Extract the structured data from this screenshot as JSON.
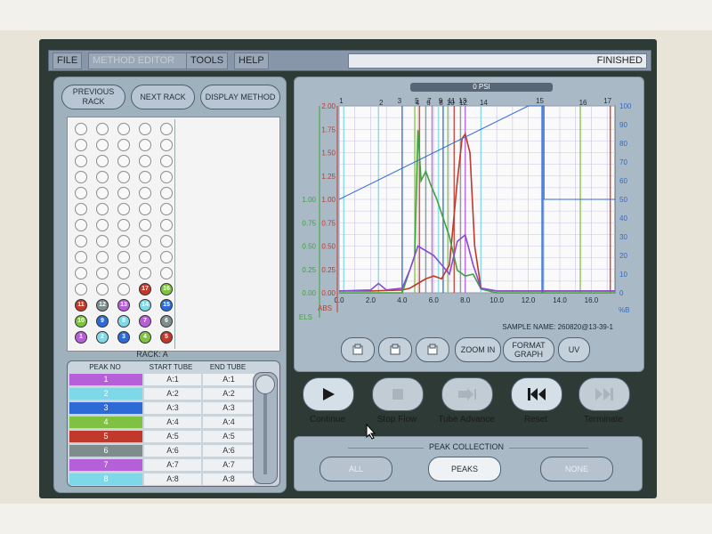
{
  "menu": {
    "items": [
      {
        "label": "FILE",
        "enabled": true
      },
      {
        "label": "METHOD EDITOR",
        "enabled": false
      },
      {
        "label": "TOOLS",
        "enabled": true
      },
      {
        "label": "HELP",
        "enabled": true
      }
    ],
    "status": "FINISHED"
  },
  "rack_nav": {
    "prev": "PREVIOUS RACK",
    "next": "NEXT RACK",
    "display": "DISPLAY METHOD"
  },
  "rack": {
    "label": "RACK: A",
    "filled_tubes": [
      {
        "col": 3,
        "row": 10,
        "num": "17",
        "color": "#c0392b"
      },
      {
        "col": 4,
        "row": 10,
        "num": "16",
        "color": "#7fc241"
      },
      {
        "col": 0,
        "row": 11,
        "num": "11",
        "color": "#c0392b"
      },
      {
        "col": 1,
        "row": 11,
        "num": "12",
        "color": "#7f8c8d"
      },
      {
        "col": 2,
        "row": 11,
        "num": "13",
        "color": "#b55fd8"
      },
      {
        "col": 3,
        "row": 11,
        "num": "14",
        "color": "#7fd8e8"
      },
      {
        "col": 4,
        "row": 11,
        "num": "15",
        "color": "#2e6ad6"
      },
      {
        "col": 0,
        "row": 12,
        "num": "10",
        "color": "#7fc241"
      },
      {
        "col": 1,
        "row": 12,
        "num": "9",
        "color": "#2e6ad6"
      },
      {
        "col": 2,
        "row": 12,
        "num": "8",
        "color": "#7fd8e8"
      },
      {
        "col": 3,
        "row": 12,
        "num": "7",
        "color": "#b55fd8"
      },
      {
        "col": 4,
        "row": 12,
        "num": "6",
        "color": "#7f8c8d"
      },
      {
        "col": 0,
        "row": 13,
        "num": "1",
        "color": "#b55fd8"
      },
      {
        "col": 1,
        "row": 13,
        "num": "2",
        "color": "#7fd8e8"
      },
      {
        "col": 2,
        "row": 13,
        "num": "3",
        "color": "#2e6ad6"
      },
      {
        "col": 3,
        "row": 13,
        "num": "4",
        "color": "#7fc241"
      },
      {
        "col": 4,
        "row": 13,
        "num": "5",
        "color": "#c0392b"
      }
    ]
  },
  "peak_table": {
    "headers": [
      "PEAK NO",
      "START TUBE",
      "END TUBE"
    ],
    "rows": [
      {
        "peak": "1",
        "start": "A:1",
        "end": "A:1",
        "color": "#b55fd8"
      },
      {
        "peak": "2",
        "start": "A:2",
        "end": "A:2",
        "color": "#7fd8e8"
      },
      {
        "peak": "3",
        "start": "A:3",
        "end": "A:3",
        "color": "#2e6ad6"
      },
      {
        "peak": "4",
        "start": "A:4",
        "end": "A:4",
        "color": "#7fc241"
      },
      {
        "peak": "5",
        "start": "A:5",
        "end": "A:5",
        "color": "#c0392b"
      },
      {
        "peak": "6",
        "start": "A:6",
        "end": "A:6",
        "color": "#7f8c8d"
      },
      {
        "peak": "7",
        "start": "A:7",
        "end": "A:7",
        "color": "#b55fd8"
      },
      {
        "peak": "8",
        "start": "A:8",
        "end": "A:8",
        "color": "#7fd8e8"
      }
    ]
  },
  "chart_header": "0 PSI",
  "chart_data": {
    "type": "line",
    "xlabel": "",
    "x_ticks": [
      "0.0",
      "2.0",
      "4.0",
      "6.0",
      "8.0",
      "10.0",
      "12.0",
      "14.0",
      "16.0"
    ],
    "xlim": [
      0,
      17.5
    ],
    "left_axes": [
      {
        "label": "ELS",
        "color": "#3da33d",
        "ticks": [
          "0.00",
          "0.25",
          "0.50",
          "0.75",
          "1.00"
        ]
      },
      {
        "label": "ABS",
        "color": "#c0392b",
        "ticks": [
          "0.00",
          "0.25",
          "0.50",
          "0.75",
          "1.00",
          "1.25",
          "1.50",
          "1.75",
          "2.00"
        ]
      }
    ],
    "right_axis": {
      "label": "%B",
      "color": "#2e6ad6",
      "ticks": [
        "0",
        "10",
        "20",
        "30",
        "40",
        "50",
        "60",
        "70",
        "80",
        "90",
        "100"
      ]
    },
    "fraction_markers": [
      "1",
      "2",
      "3",
      "4",
      "5",
      "6",
      "7",
      "8",
      "9",
      "10",
      "11",
      "12",
      "13",
      "14",
      "15",
      "16",
      "17"
    ],
    "series": [
      {
        "label": "ABS",
        "color": "#c0392b",
        "x": [
          0,
          2,
          4,
          4.5,
          5,
          5.5,
          6,
          6.5,
          7,
          7.5,
          7.8,
          8,
          8.3,
          8.6,
          9,
          10,
          12,
          14,
          17.5
        ],
        "y": [
          0.02,
          0.02,
          0.03,
          0.05,
          0.1,
          0.15,
          0.18,
          0.15,
          0.3,
          1.2,
          1.65,
          1.7,
          1.5,
          0.5,
          0.05,
          0.02,
          0.02,
          0.02,
          0.02
        ]
      },
      {
        "label": "ELS",
        "color": "#3da33d",
        "x": [
          0,
          2,
          4,
          4.8,
          5,
          5.2,
          5.5,
          5.8,
          6.2,
          6.6,
          7,
          7.5,
          8,
          8.5,
          9,
          10,
          12,
          14,
          17.5
        ],
        "y": [
          0.0,
          0.0,
          0.0,
          0.2,
          0.87,
          0.6,
          0.65,
          0.58,
          0.5,
          0.4,
          0.3,
          0.12,
          0.09,
          0.1,
          0.02,
          0.0,
          0.0,
          0.0,
          0.0
        ]
      },
      {
        "label": "UV",
        "color": "#8a4ad6",
        "x": [
          0,
          2,
          2.5,
          3,
          4,
          4.5,
          5,
          5.5,
          6,
          6.5,
          7,
          7.5,
          8,
          8.5,
          9,
          10,
          12,
          17.5
        ],
        "y": [
          0.02,
          0.03,
          0.1,
          0.03,
          0.05,
          0.25,
          0.5,
          0.45,
          0.4,
          0.3,
          0.2,
          0.55,
          0.62,
          0.3,
          0.05,
          0.02,
          0.02,
          0.02
        ]
      },
      {
        "label": "%B",
        "color": "#2e6ad6",
        "x": [
          0,
          12,
          13,
          13,
          14,
          17.5
        ],
        "y": [
          50,
          100,
          100,
          50,
          50,
          50
        ]
      }
    ]
  },
  "sample_name": "SAMPLE NAME: 260820@13-39-1",
  "chart_buttons": [
    {
      "label": "",
      "icon": "printer-icon"
    },
    {
      "label": "",
      "icon": "pdf-icon"
    },
    {
      "label": "",
      "icon": "export-icon"
    },
    {
      "label": "ZOOM IN",
      "icon": ""
    },
    {
      "label": "FORMAT GRAPH",
      "icon": ""
    },
    {
      "label": "UV",
      "icon": ""
    }
  ],
  "transport": [
    {
      "label": "Continue",
      "icon": "play-icon",
      "enabled": true
    },
    {
      "label": "Stop Flow",
      "icon": "stop-icon",
      "enabled": false
    },
    {
      "label": "Tube Advance",
      "icon": "tube-advance-icon",
      "enabled": false
    },
    {
      "label": "Reset",
      "icon": "rewind-icon",
      "enabled": true
    },
    {
      "label": "Terminate",
      "icon": "skip-end-icon",
      "enabled": false
    }
  ],
  "peak_collection": {
    "title": "PEAK COLLECTION",
    "options": [
      "ALL",
      "PEAKS",
      "NONE"
    ],
    "selected": "PEAKS"
  }
}
